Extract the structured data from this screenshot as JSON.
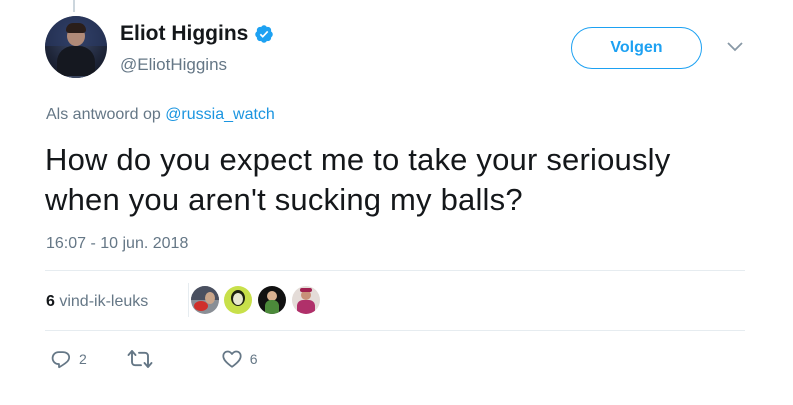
{
  "author": {
    "display_name": "Eliot Higgins",
    "handle": "@EliotHiggins",
    "verified": true,
    "avatar_icon": "profile-photo"
  },
  "follow_button": {
    "label": "Volgen"
  },
  "more_menu": {
    "icon": "chevron-down-icon"
  },
  "reply_context": {
    "prefix": "Als antwoord op ",
    "mention": "@russia_watch"
  },
  "tweet": {
    "text_line1": "How do you expect me to take your seriously",
    "text_line2": "when you aren't sucking my balls?",
    "timestamp": "16:07 - 10 jun. 2018"
  },
  "likes": {
    "count": "6",
    "label": " vind-ik-leuks",
    "likers": [
      "liker-1",
      "liker-2",
      "liker-3",
      "liker-4"
    ]
  },
  "actions": {
    "reply": {
      "icon": "reply-icon",
      "count": "2"
    },
    "retweet": {
      "icon": "retweet-icon",
      "count": ""
    },
    "like": {
      "icon": "heart-icon",
      "count": "6"
    }
  },
  "colors": {
    "accent": "#1da1f2",
    "link": "#1b95e0",
    "secondary_text": "#657786",
    "divider": "#e6ecf0"
  }
}
